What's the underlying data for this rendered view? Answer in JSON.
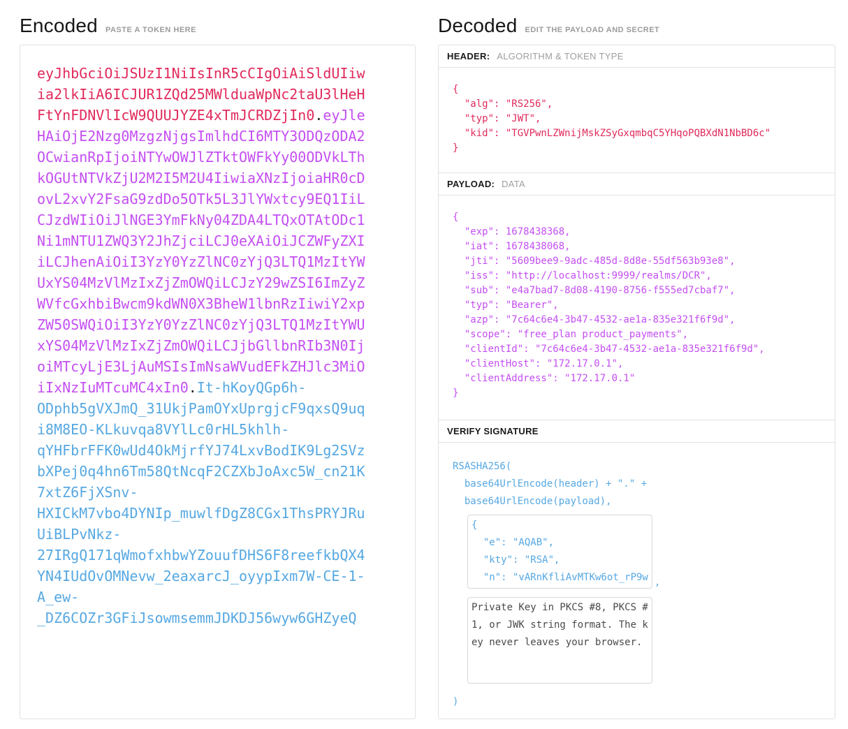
{
  "encoded": {
    "title": "Encoded",
    "subtitle": "PASTE A TOKEN HERE",
    "token": {
      "header_part": "eyJhbGciOiJSUzI1NiIsInR5cCIgOiAiSldUIiwia2lkIiA6ICJUR1ZQd25MWlduaWpNc2taU3lHeHFtYnFDNVlIcW9QUUJYZE4xTmJCRDZjIn0",
      "separator": ".",
      "payload_part": "eyJleHAiOjE2Nzg0MzgzNjgsImlhdCI6MTY3ODQzODA2OCwianRpIjoiNTYwOWJlZTktOWFkYy00ODVkLThkOGUtNTVkZjU2M2I5M2U4IiwiaXNzIjoiaHR0cDovL2xvY2FsaG9zdDo5OTk5L3JlYWxtcy9EQ1IiLCJzdWIiOiJlNGE3YmFkNy04ZDA4LTQxOTAtODc1Ni1mNTU1ZWQ3Y2JhZjciLCJ0eXAiOiJCZWFyZXIiLCJhenAiOiI3YzY0YzZlNC0zYjQ3LTQ1MzItYWUxYS04MzVlMzIxZjZmOWQiLCJzY29wZSI6ImZyZWVfcGxhbiBwcm9kdWN0X3BheW1lbnRzIiwiY2xpZW50SWQiOiI3YzY0YzZlNC0zYjQ3LTQ1MzItYWUxYS04MzVlMzIxZjZmOWQiLCJjbGllbnRIb3N0IjoiMTcyLjE3LjAuMSIsImNsaWVudEFkZHJlc3MiOiIxNzIuMTcuMC4xIn0",
      "signature_part": "It-hKoyQGp6h-ODphb5gVXJmQ_31UkjPamOYxUprgjcF9qxsQ9uqi8M8EO-KLkuvqa8VYlLc0rHL5khlh-qYHFbrFFK0wUd4OkMjrfYJ74LxvBodIK9Lg2SVzbXPej0q4hn6Tm58QtNcqF2CZXbJoAxc5W_cn21K7xtZ6FjXSnv-HXICkM7vbo4DYNIp_muwlfDgZ8CGx1ThsPRYJRuUiBLPvNkz-27IRgQ171qWmofxhbwYZouufDHS6F8reefkbQX4YN4IUdOvOMNevw_2eaxarcJ_oyypIxm7W-CE-1-A_ew-_DZ6COZr3GFiJsowmsemmJDKDJ56wyw6GHZyeQ"
    }
  },
  "decoded": {
    "title": "Decoded",
    "subtitle": "EDIT THE PAYLOAD AND SECRET",
    "header_section": {
      "label": "HEADER:",
      "sublabel": "ALGORITHM & TOKEN TYPE",
      "json": "{\n  \"alg\": \"RS256\",\n  \"typ\": \"JWT\",\n  \"kid\": \"TGVPwnLZWnijMskZSyGxqmbqC5YHqoPQBXdN1NbBD6c\"\n}"
    },
    "payload_section": {
      "label": "PAYLOAD:",
      "sublabel": "DATA",
      "json": "{\n  \"exp\": 1678438368,\n  \"iat\": 1678438068,\n  \"jti\": \"5609bee9-9adc-485d-8d8e-55df563b93e8\",\n  \"iss\": \"http://localhost:9999/realms/DCR\",\n  \"sub\": \"e4a7bad7-8d08-4190-8756-f555ed7cbaf7\",\n  \"typ\": \"Bearer\",\n  \"azp\": \"7c64c6e4-3b47-4532-ae1a-835e321f6f9d\",\n  \"scope\": \"free_plan product_payments\",\n  \"clientId\": \"7c64c6e4-3b47-4532-ae1a-835e321f6f9d\",\n  \"clientHost\": \"172.17.0.1\",\n  \"clientAddress\": \"172.17.0.1\"\n}"
    },
    "verify_section": {
      "label": "VERIFY SIGNATURE",
      "formula": "RSASHA256(\n  base64UrlEncode(header) + \".\" +\n  base64UrlEncode(payload),",
      "public_key_value": "{\n  \"e\": \"AQAB\",\n  \"kty\": \"RSA\",\n  \"n\": \"vARnKfliAvMTKw6ot_rP9w",
      "comma": ",",
      "private_key_placeholder": "Private Key in PKCS #8, PKCS #1, or JWK string format. The key never leaves your browser.",
      "closing_paren": ")"
    }
  },
  "colors": {
    "header_segment": "#e12a5b",
    "payload_segment": "#c44ef2",
    "signature_segment": "#56a8e2",
    "muted_label": "#9b9b9b",
    "border": "#e0e0e0"
  }
}
